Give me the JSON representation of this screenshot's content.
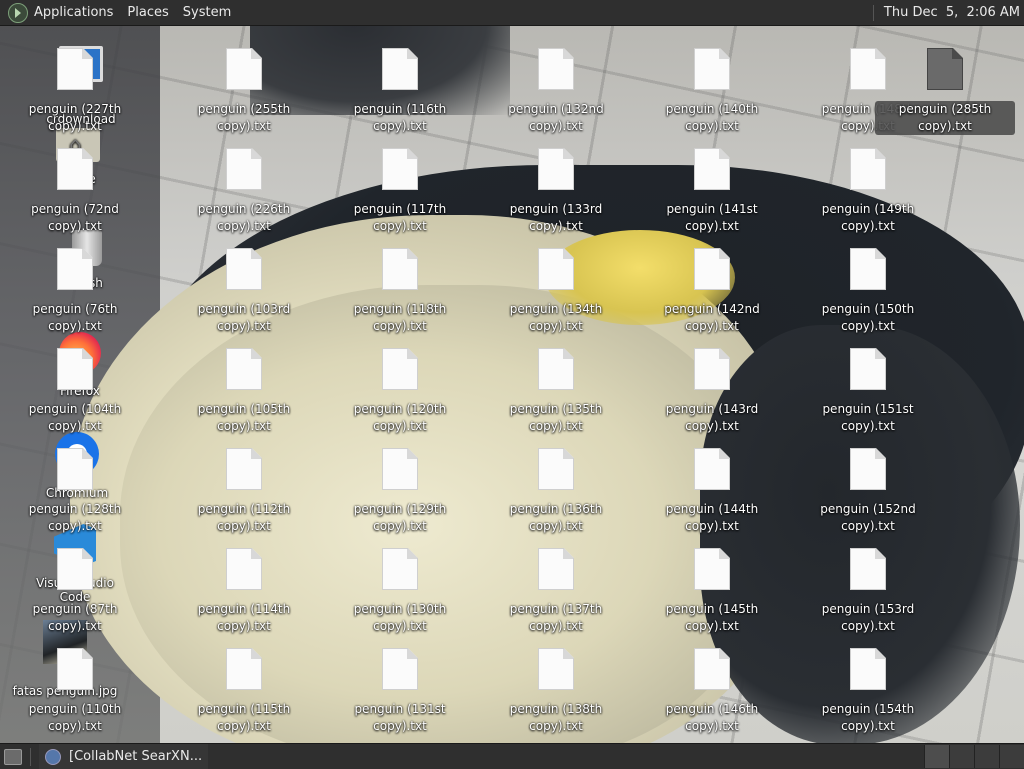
{
  "top_panel": {
    "menus": [
      "Applications",
      "Places",
      "System"
    ],
    "clock": "Thu Dec  5,  2:06 AM"
  },
  "left_column": {
    "special_icons": [
      {
        "label": "crdownload",
        "icon": "monitor-icon"
      },
      {
        "label": "Home",
        "icon": "home-folder-icon"
      },
      {
        "label": "Trash",
        "icon": "trash-icon"
      },
      {
        "label": "Firefox",
        "icon": "firefox-icon"
      },
      {
        "label": "Chromium",
        "icon": "chrome-icon"
      },
      {
        "label": "Visual Studio Code",
        "icon": "vscode-icon"
      },
      {
        "label": "fatas penguin.jpg",
        "icon": "image-file-icon"
      }
    ],
    "overlapping_file_labels": [
      "penguin (227th copy).txt",
      "penguin (72nd copy).txt",
      "penguin (76th copy).txt",
      "penguin (104th copy).txt",
      "penguin (128th copy).txt",
      "penguin (87th copy).txt",
      "penguin (110th copy).txt"
    ]
  },
  "files": [
    {
      "col": 1,
      "row": 0,
      "label": "penguin (255th copy).txt"
    },
    {
      "col": 1,
      "row": 1,
      "label": "penguin (226th copy).txt"
    },
    {
      "col": 1,
      "row": 2,
      "label": "penguin (103rd copy).txt"
    },
    {
      "col": 1,
      "row": 3,
      "label": "penguin (105th copy).txt"
    },
    {
      "col": 1,
      "row": 4,
      "label": "penguin (112th copy).txt"
    },
    {
      "col": 1,
      "row": 5,
      "label": "penguin (114th copy).txt"
    },
    {
      "col": 1,
      "row": 6,
      "label": "penguin (115th copy).txt"
    },
    {
      "col": 2,
      "row": 0,
      "label": "penguin (116th copy).txt"
    },
    {
      "col": 2,
      "row": 1,
      "label": "penguin (117th copy).txt"
    },
    {
      "col": 2,
      "row": 2,
      "label": "penguin (118th copy).txt"
    },
    {
      "col": 2,
      "row": 3,
      "label": "penguin (120th copy).txt"
    },
    {
      "col": 2,
      "row": 4,
      "label": "penguin (129th copy).txt"
    },
    {
      "col": 2,
      "row": 5,
      "label": "penguin (130th copy).txt"
    },
    {
      "col": 2,
      "row": 6,
      "label": "penguin (131st copy).txt"
    },
    {
      "col": 3,
      "row": 0,
      "label": "penguin (132nd copy).txt"
    },
    {
      "col": 3,
      "row": 1,
      "label": "penguin (133rd copy).txt"
    },
    {
      "col": 3,
      "row": 2,
      "label": "penguin (134th copy).txt"
    },
    {
      "col": 3,
      "row": 3,
      "label": "penguin (135th copy).txt"
    },
    {
      "col": 3,
      "row": 4,
      "label": "penguin (136th copy).txt"
    },
    {
      "col": 3,
      "row": 5,
      "label": "penguin (137th copy).txt"
    },
    {
      "col": 3,
      "row": 6,
      "label": "penguin (138th copy).txt"
    },
    {
      "col": 4,
      "row": 0,
      "label": "penguin (140th copy).txt"
    },
    {
      "col": 4,
      "row": 1,
      "label": "penguin (141st copy).txt"
    },
    {
      "col": 4,
      "row": 2,
      "label": "penguin (142nd copy).txt"
    },
    {
      "col": 4,
      "row": 3,
      "label": "penguin (143rd copy).txt"
    },
    {
      "col": 4,
      "row": 4,
      "label": "penguin (144th copy).txt"
    },
    {
      "col": 4,
      "row": 5,
      "label": "penguin (145th copy).txt"
    },
    {
      "col": 4,
      "row": 6,
      "label": "penguin (146th copy).txt"
    },
    {
      "col": 5,
      "row": 0,
      "label": "penguin (148th copy).txt"
    },
    {
      "col": 5,
      "row": 1,
      "label": "penguin (149th copy).txt"
    },
    {
      "col": 5,
      "row": 2,
      "label": "penguin (150th copy).txt"
    },
    {
      "col": 5,
      "row": 3,
      "label": "penguin (151st copy).txt"
    },
    {
      "col": 5,
      "row": 4,
      "label": "penguin (152nd copy).txt"
    },
    {
      "col": 5,
      "row": 5,
      "label": "penguin (153rd copy).txt"
    },
    {
      "col": 5,
      "row": 6,
      "label": "penguin (154th copy).txt"
    }
  ],
  "selected_file": {
    "label": "penguin (285th copy).txt"
  },
  "bottom_panel": {
    "task_label": "[CollabNet SearXN..."
  }
}
